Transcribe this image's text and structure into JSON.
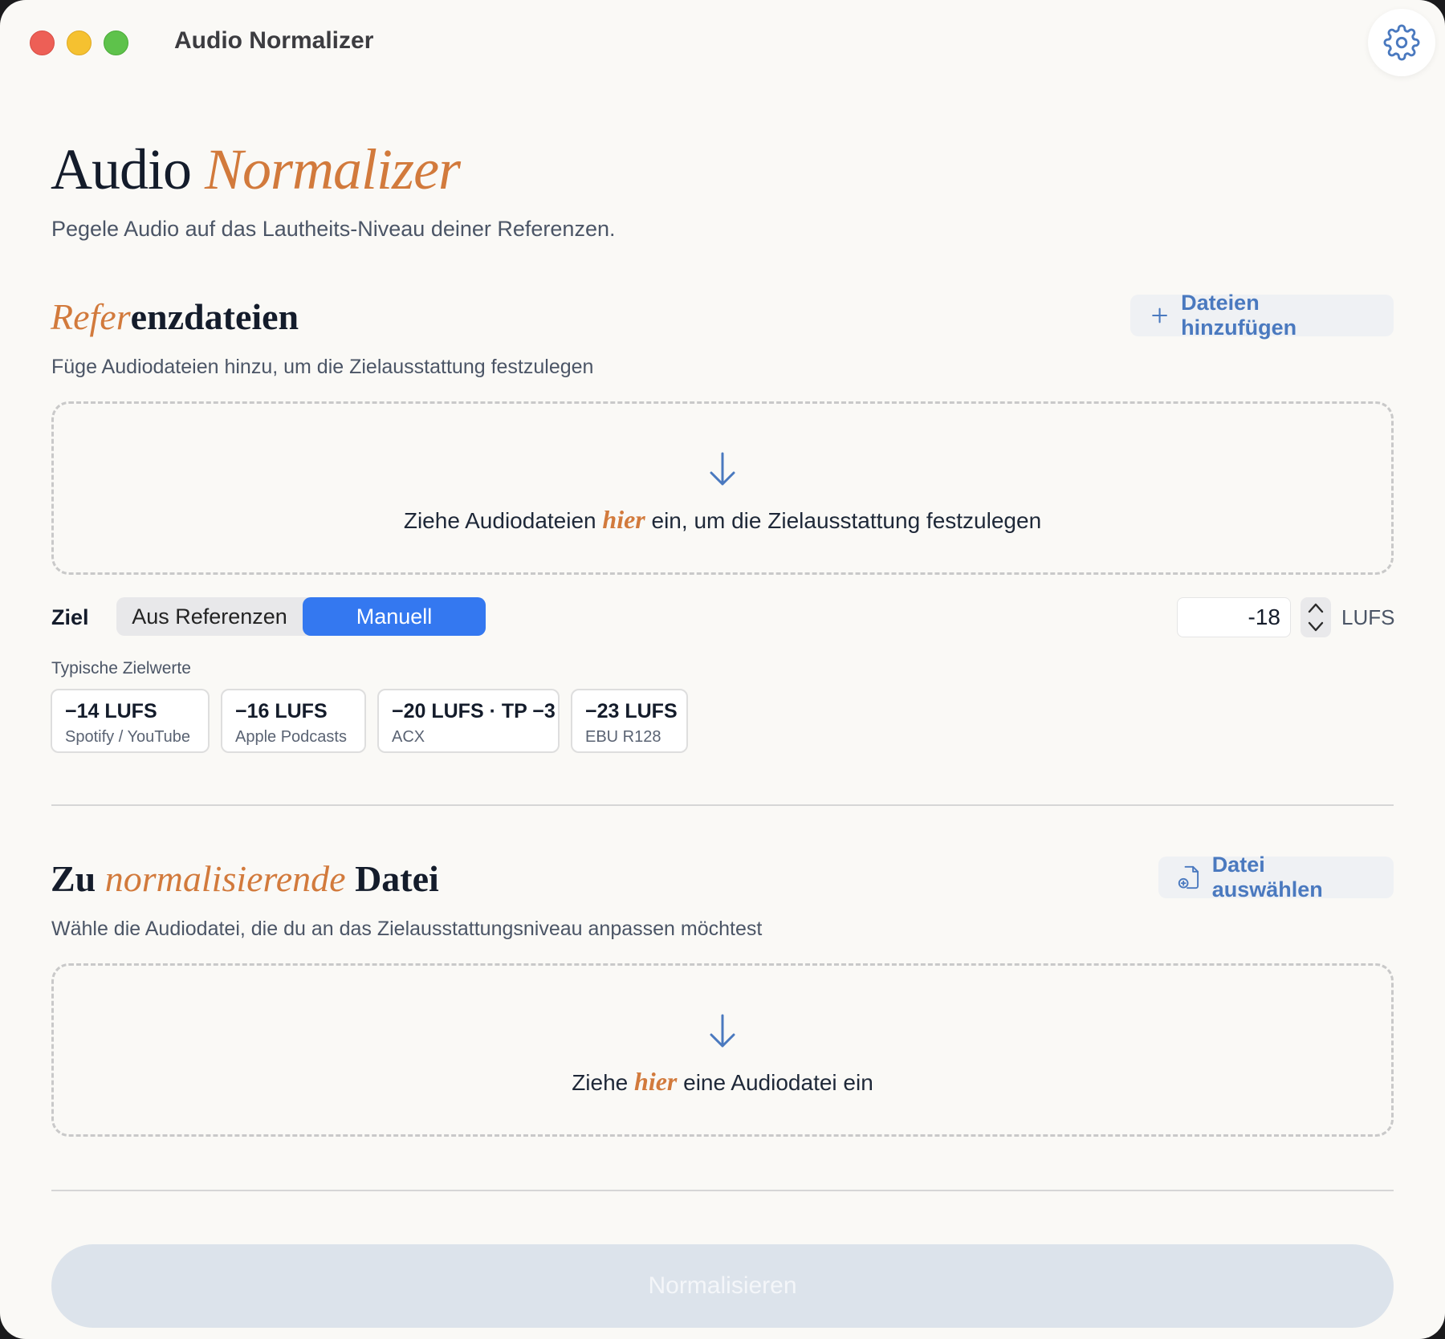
{
  "window": {
    "title": "Audio Normalizer"
  },
  "header": {
    "title_plain": "Audio ",
    "title_accent": "Normalizer",
    "subtitle": "Pegele Audio auf das Lautheits-Niveau deiner Referenzen."
  },
  "references": {
    "title_accent": "Refer",
    "title_rest": "enzdateien",
    "subtitle": "Füge Audiodateien hinzu, um die Zielausstattung festzulegen",
    "add_button": "Dateien hinzufügen",
    "dropzone": {
      "text_before": "Ziehe Audiodateien ",
      "text_accent": "hier",
      "text_after": " ein, um die Zielausstattung festzulegen"
    }
  },
  "target": {
    "label": "Ziel",
    "mode_options": [
      "Aus Referenzen",
      "Manuell"
    ],
    "selected_mode": "Manuell",
    "value": "-18",
    "unit": "LUFS",
    "presets_label": "Typische Zielwerte",
    "presets": [
      {
        "value": "−14 LUFS",
        "desc": "Spotify / YouTube"
      },
      {
        "value": "−16 LUFS",
        "desc": "Apple Podcasts"
      },
      {
        "value": "−20 LUFS · TP −3",
        "desc": "ACX"
      },
      {
        "value": "−23 LUFS",
        "desc": "EBU R128"
      }
    ]
  },
  "input_file": {
    "title_plain_1": "Zu ",
    "title_accent": "normalisierende",
    "title_plain_2": " Datei",
    "subtitle": "Wähle die Audiodatei, die du an das Zielausstattungsniveau anpassen möchtest",
    "select_button": "Datei auswählen",
    "dropzone": {
      "text_before": "Ziehe ",
      "text_accent": "hier",
      "text_after": " eine Audiodatei ein"
    }
  },
  "actions": {
    "normalize_button": "Normalisieren",
    "normalize_enabled": false
  },
  "colors": {
    "accent": "#d27a3c",
    "primary": "#3478f0",
    "link": "#4a79bf",
    "disabled_button": "#dce3eb"
  },
  "icons": [
    "gear-icon",
    "plus-icon",
    "arrow-down-icon",
    "chevron-up-icon",
    "chevron-down-icon",
    "file-add-icon"
  ]
}
